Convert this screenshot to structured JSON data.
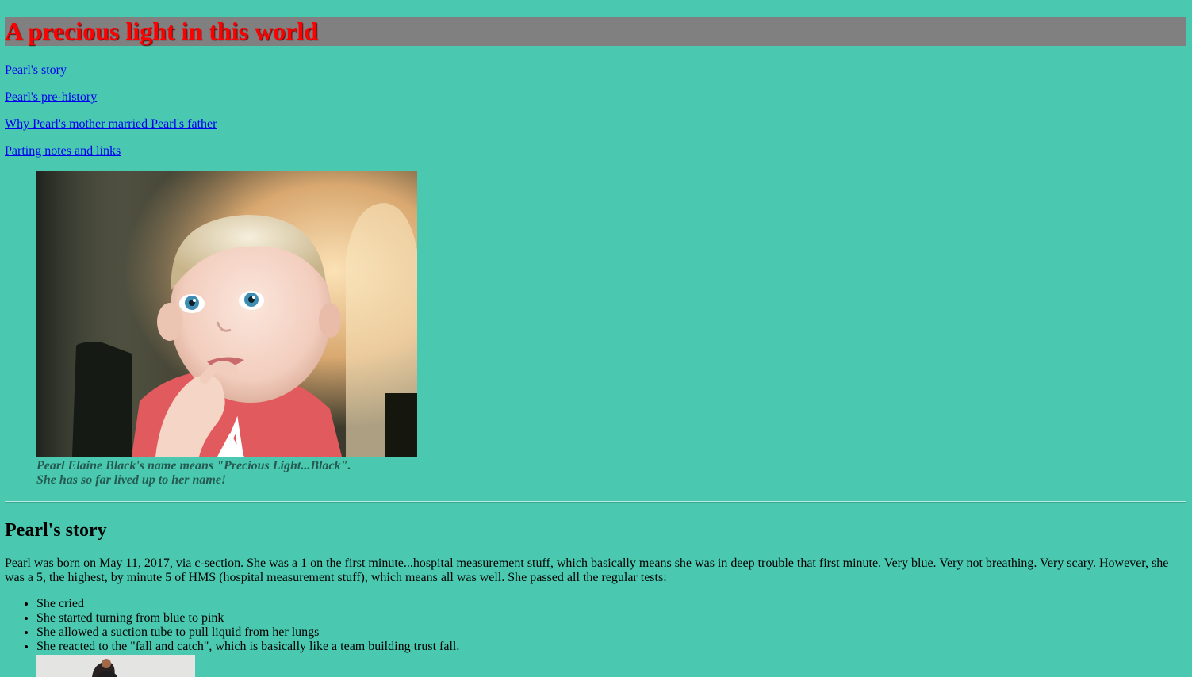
{
  "header": {
    "title": "A precious light in this world"
  },
  "nav": {
    "links": [
      {
        "label": "Pearl's story"
      },
      {
        "label": "Pearl's pre-history"
      },
      {
        "label": "Why Pearl's mother married Pearl's father"
      },
      {
        "label": "Parting notes and links"
      }
    ]
  },
  "hero": {
    "caption_line1": "Pearl Elaine Black's name means \"Precious Light...Black\".",
    "caption_line2": "She has so far lived up to her name!"
  },
  "story": {
    "heading": "Pearl's story",
    "intro": "Pearl was born on May 11, 2017, via c-section. She was a 1 on the first minute...hospital measurement stuff, which basically means she was in deep trouble that first minute. Very blue. Very not breathing. Very scary. However, she was a 5, the highest, by minute 5 of HMS (hospital measurement stuff), which means all was well. She passed all the regular tests:",
    "tests": [
      "She cried",
      "She started turning from blue to pink",
      "She allowed a suction tube to pull liquid from her lungs",
      "She reacted to the \"fall and catch\", which is basically like a team building trust fall."
    ]
  },
  "colors": {
    "page_background": "#4ac9b0",
    "title_band": "#808080",
    "title_text": "#ff0000",
    "link": "#0000ee",
    "caption_text": "#245a52"
  }
}
